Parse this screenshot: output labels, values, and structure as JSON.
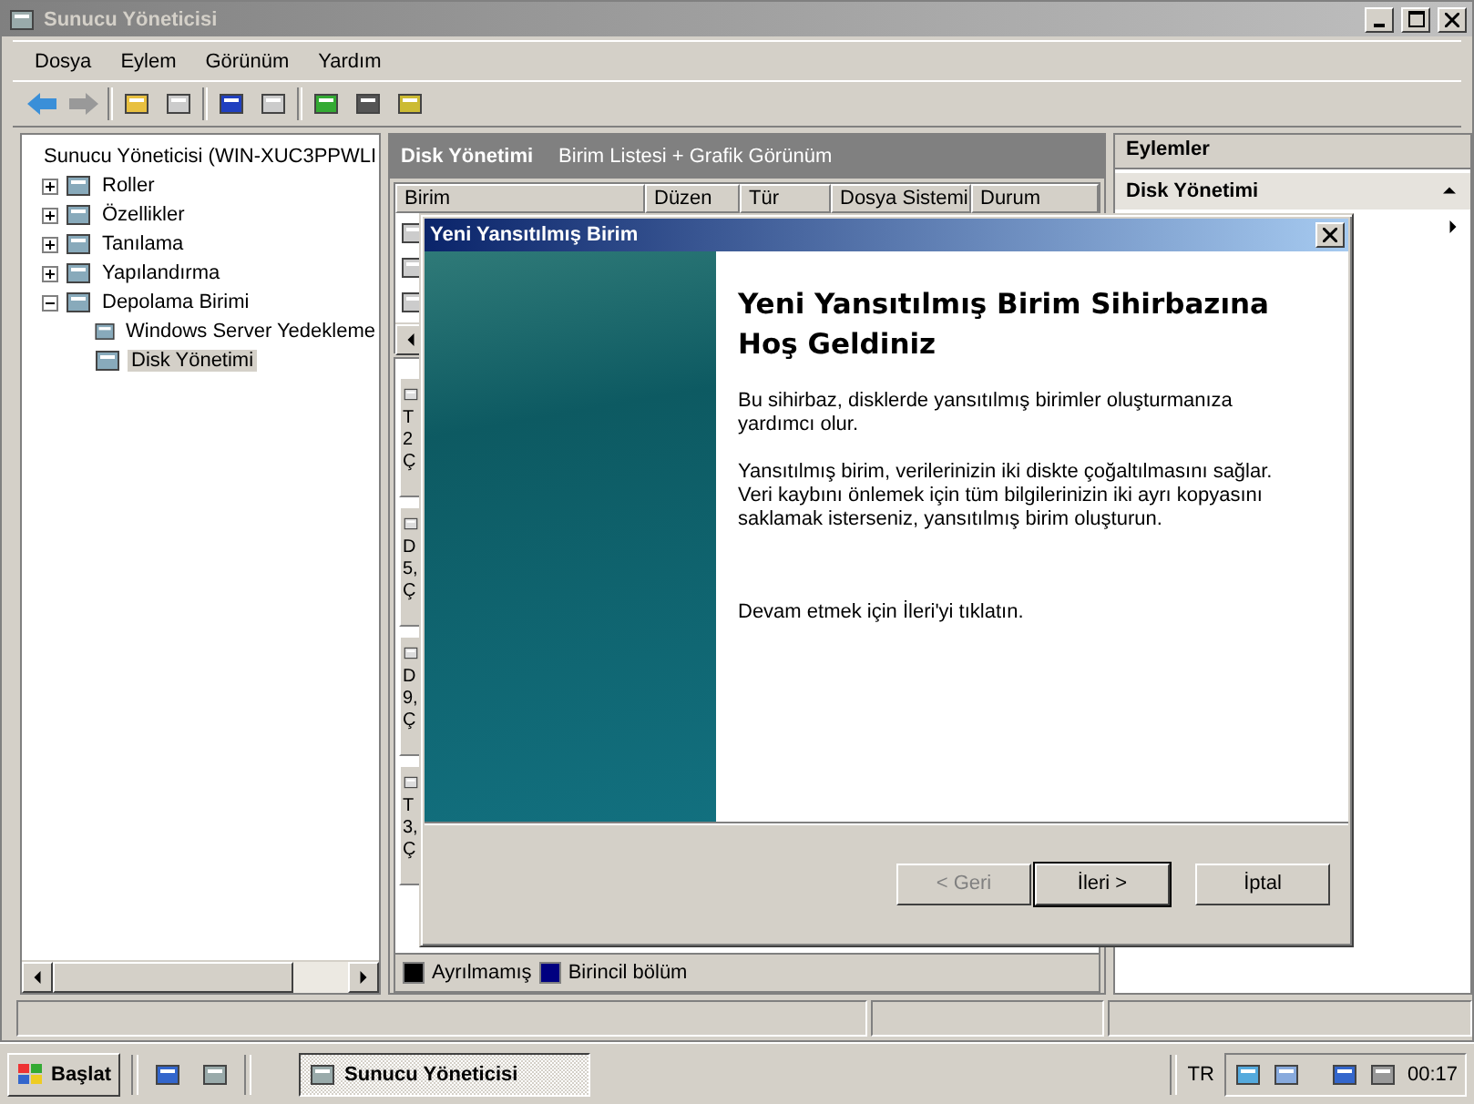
{
  "window": {
    "title": "Sunucu Yöneticisi"
  },
  "menu": [
    "Dosya",
    "Eylem",
    "Görünüm",
    "Yardım"
  ],
  "tree": [
    {
      "label": "Sunucu Yöneticisi (WIN-XUC3PPWLI",
      "selected": false,
      "children": [
        {
          "label": "Roller",
          "expanded": false,
          "selected": false
        },
        {
          "label": "Özellikler",
          "expanded": false,
          "selected": false
        },
        {
          "label": "Tanılama",
          "expanded": false,
          "selected": false
        },
        {
          "label": "Yapılandırma",
          "expanded": false,
          "selected": false
        },
        {
          "label": "Depolama Birimi",
          "expanded": true,
          "selected": false,
          "children": [
            {
              "label": "Windows Server Yedekleme",
              "selected": false
            },
            {
              "label": "Disk Yönetimi",
              "selected": true
            }
          ]
        }
      ]
    }
  ],
  "center": {
    "title": "Disk Yönetimi",
    "subtitle": "Birim Listesi + Grafik Görünüm",
    "columns": [
      "Birim",
      "Düzen",
      "Tür",
      "Dosya Sistemi",
      "Durum"
    ],
    "disks": [
      [
        "T",
        "2",
        "Ç"
      ],
      [
        "D",
        "5,",
        "Ç"
      ],
      [
        "D",
        "9,",
        "Ç"
      ],
      [
        "T",
        "3,",
        "Ç"
      ]
    ],
    "legend": [
      {
        "label": "Ayrılmamış",
        "color": "#000000"
      },
      {
        "label": "Birincil bölüm",
        "color": "#000080"
      }
    ]
  },
  "actions": {
    "title": "Eylemler",
    "section": "Disk Yönetimi",
    "expanded": true
  },
  "dialog": {
    "title": "Yeni Yansıtılmış Birim",
    "heading": "Yeni Yansıtılmış Birim Sihirbazına Hoş Geldiniz",
    "paragraphs": [
      "Bu sihirbaz, disklerde yansıtılmış birimler oluşturmanıza yardımcı olur.",
      "Yansıtılmış birim, verilerinizin iki diskte çoğaltılmasını sağlar. Veri kaybını önlemek için tüm bilgilerinizin iki ayrı kopyasını saklamak isterseniz, yansıtılmış birim oluşturun.",
      "Devam etmek için İleri'yi tıklatın."
    ],
    "buttons": [
      {
        "label": "< Geri",
        "disabled": true,
        "default": false
      },
      {
        "label": "İleri >",
        "disabled": false,
        "default": true
      },
      {
        "label": "İptal",
        "disabled": false,
        "default": false
      }
    ]
  },
  "taskbar": {
    "start": "Başlat",
    "tasks": [
      {
        "label": "Sunucu Yöneticisi",
        "selected": true
      }
    ],
    "language": "TR",
    "clock": "00:17"
  }
}
